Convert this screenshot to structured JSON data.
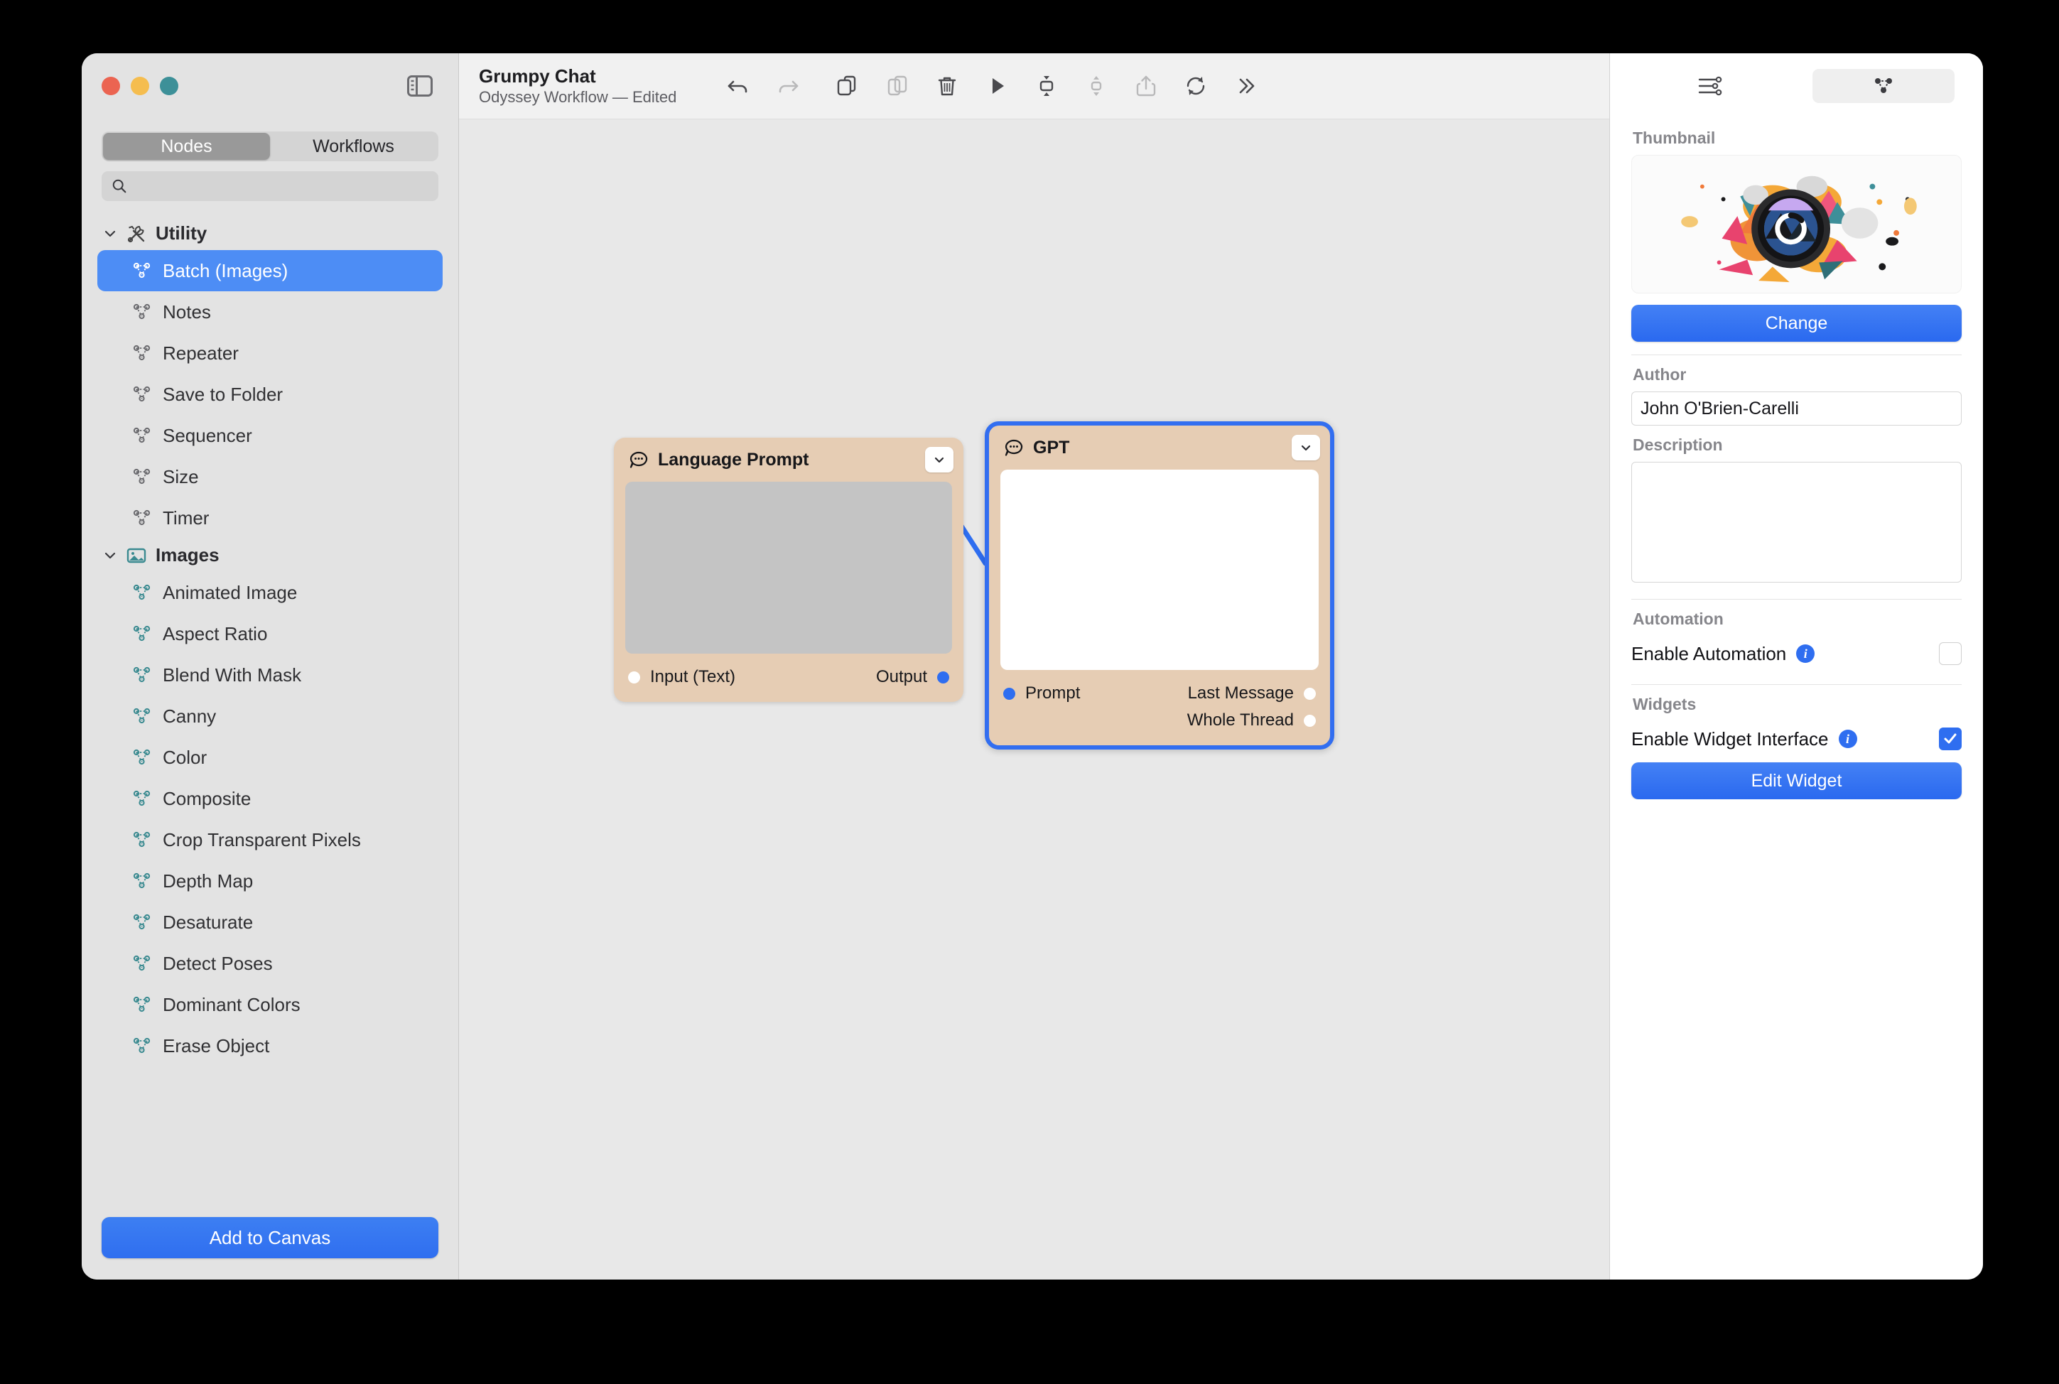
{
  "window": {
    "traffic_lights": [
      "close",
      "minimize",
      "zoom"
    ],
    "sidebar_toggle_icon": "sidebar-toggle-icon"
  },
  "sidebar": {
    "segments": [
      {
        "label": "Nodes",
        "active": true
      },
      {
        "label": "Workflows",
        "active": false
      }
    ],
    "search": {
      "placeholder": "",
      "value": "",
      "icon": "search-icon"
    },
    "groups": [
      {
        "label": "Utility",
        "icon": "tools-icon",
        "expanded": true,
        "items": [
          {
            "label": "Batch (Images)",
            "selected": true
          },
          {
            "label": "Notes",
            "selected": false
          },
          {
            "label": "Repeater",
            "selected": false
          },
          {
            "label": "Save to Folder",
            "selected": false
          },
          {
            "label": "Sequencer",
            "selected": false
          },
          {
            "label": "Size",
            "selected": false
          },
          {
            "label": "Timer",
            "selected": false
          }
        ]
      },
      {
        "label": "Images",
        "icon": "photo-icon",
        "expanded": true,
        "items": [
          {
            "label": "Animated Image",
            "selected": false
          },
          {
            "label": "Aspect Ratio",
            "selected": false
          },
          {
            "label": "Blend With Mask",
            "selected": false
          },
          {
            "label": "Canny",
            "selected": false
          },
          {
            "label": "Color",
            "selected": false
          },
          {
            "label": "Composite",
            "selected": false
          },
          {
            "label": "Crop Transparent Pixels",
            "selected": false
          },
          {
            "label": "Depth Map",
            "selected": false
          },
          {
            "label": "Desaturate",
            "selected": false
          },
          {
            "label": "Detect Poses",
            "selected": false
          },
          {
            "label": "Dominant Colors",
            "selected": false
          },
          {
            "label": "Erase Object",
            "selected": false
          }
        ]
      }
    ],
    "add_to_canvas_label": "Add to Canvas"
  },
  "toolbar": {
    "document_title": "Grumpy Chat",
    "document_subtitle": "Odyssey Workflow — Edited",
    "buttons": [
      {
        "name": "undo-icon",
        "dim": false
      },
      {
        "name": "redo-icon",
        "dim": true
      },
      {
        "name": "copy-icon",
        "dim": false
      },
      {
        "name": "paste-icon",
        "dim": true
      },
      {
        "name": "trash-icon",
        "dim": false
      },
      {
        "name": "play-icon",
        "dim": false
      },
      {
        "name": "collapse-icon",
        "dim": false
      },
      {
        "name": "expand-icon",
        "dim": true
      },
      {
        "name": "share-icon",
        "dim": true
      },
      {
        "name": "refresh-icon",
        "dim": false
      },
      {
        "name": "more-icon",
        "dim": false
      }
    ]
  },
  "canvas": {
    "nodes": [
      {
        "id": "language-prompt",
        "title": "Language Prompt",
        "icon": "chat-bubble-icon",
        "selected": false,
        "body_style": "gray",
        "inputs": [
          {
            "label": "Input (Text)",
            "dot": "white"
          }
        ],
        "outputs": [
          {
            "label": "Output",
            "dot": "blue"
          }
        ]
      },
      {
        "id": "gpt",
        "title": "GPT",
        "icon": "chat-bubble-icon",
        "selected": true,
        "body_style": "white",
        "inputs": [
          {
            "label": "Prompt",
            "dot": "blue"
          }
        ],
        "outputs": [
          {
            "label": "Last Message",
            "dot": "white"
          },
          {
            "label": "Whole Thread",
            "dot": "white"
          }
        ]
      }
    ],
    "connection": {
      "from": "language-prompt.Output",
      "to": "gpt.Prompt",
      "color": "#2f6ef0"
    }
  },
  "inspector": {
    "tabs": [
      {
        "name": "settings-sliders-icon",
        "active": false
      },
      {
        "name": "node-graph-icon",
        "active": true
      }
    ],
    "thumbnail_label": "Thumbnail",
    "change_button_label": "Change",
    "author_label": "Author",
    "author_value": "John O'Brien-Carelli",
    "description_label": "Description",
    "description_value": "",
    "automation_label": "Automation",
    "enable_automation_label": "Enable Automation",
    "enable_automation_checked": false,
    "widgets_label": "Widgets",
    "enable_widget_label": "Enable Widget Interface",
    "enable_widget_checked": true,
    "edit_widget_label": "Edit Widget"
  },
  "colors": {
    "accent": "#2f6ef0",
    "node_fill": "#e6cdb4",
    "selection": "#326ef0",
    "sidebar_bg": "#e3e3e3",
    "canvas_bg": "#e8e8e8"
  }
}
